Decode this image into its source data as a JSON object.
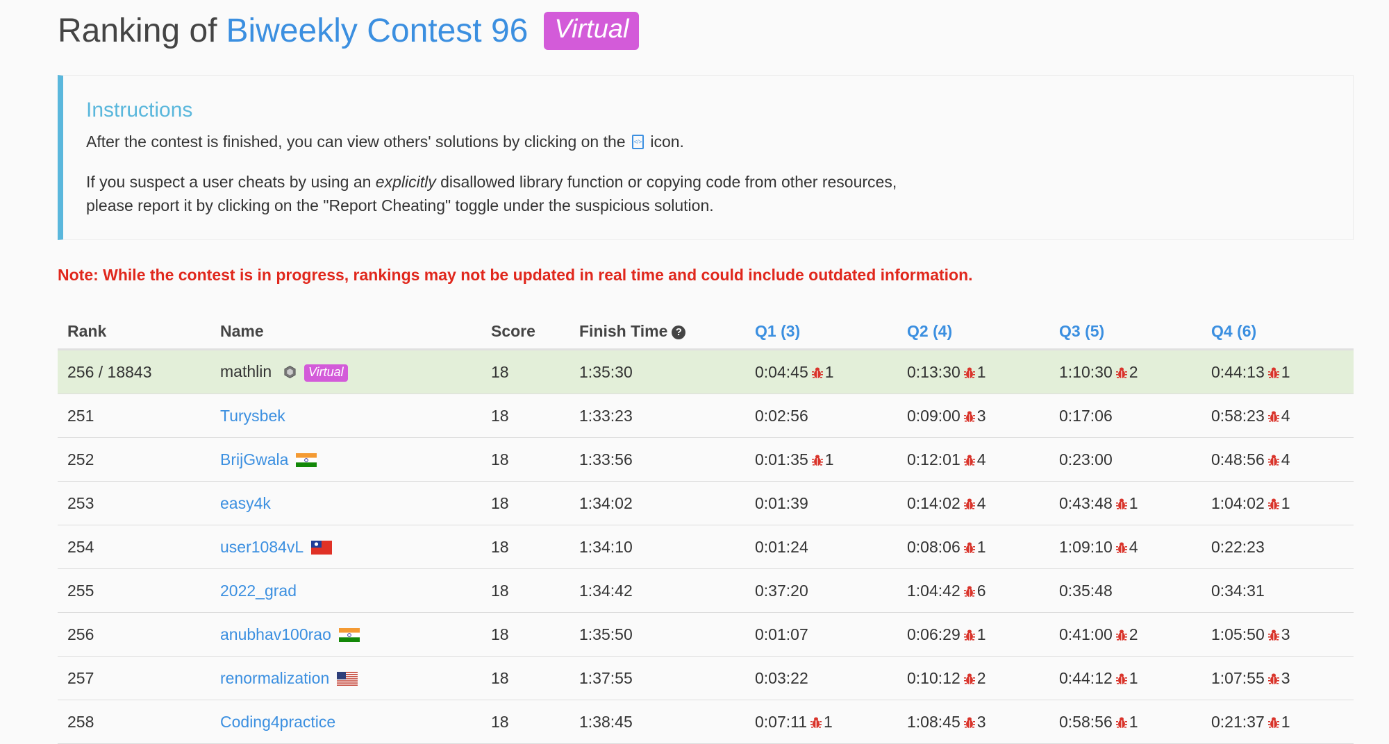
{
  "header": {
    "prefix": "Ranking of",
    "contest_name": "Biweekly Contest 96",
    "badge": "Virtual"
  },
  "instructions": {
    "title": "Instructions",
    "line1_before": "After the contest is finished, you can view others' solutions by clicking on the",
    "line1_after": "icon.",
    "line2_before": "If you suspect a user cheats by using an",
    "line2_em": "explicitly",
    "line2_after": "disallowed library function or copying code from other resources,",
    "line3": "please report it by clicking on the \"Report Cheating\" toggle under the suspicious solution."
  },
  "note": "Note: While the contest is in progress, rankings may not be updated in real time and could include outdated information.",
  "table": {
    "headers": {
      "rank": "Rank",
      "name": "Name",
      "score": "Score",
      "finish": "Finish Time",
      "q1": "Q1 (3)",
      "q2": "Q2 (4)",
      "q3": "Q3 (5)",
      "q4": "Q4 (6)"
    },
    "self_row": {
      "rank": "256 / 18843",
      "name": "mathlin",
      "badge": "Virtual",
      "score": "18",
      "finish": "1:35:30",
      "q1": {
        "time": "0:04:45",
        "wrong": "1"
      },
      "q2": {
        "time": "0:13:30",
        "wrong": "1"
      },
      "q3": {
        "time": "1:10:30",
        "wrong": "2"
      },
      "q4": {
        "time": "0:44:13",
        "wrong": "1"
      }
    },
    "rows": [
      {
        "rank": "251",
        "name": "Turysbek",
        "flag": "",
        "score": "18",
        "finish": "1:33:23",
        "q1": {
          "time": "0:02:56",
          "wrong": ""
        },
        "q2": {
          "time": "0:09:00",
          "wrong": "3"
        },
        "q3": {
          "time": "0:17:06",
          "wrong": ""
        },
        "q4": {
          "time": "0:58:23",
          "wrong": "4"
        }
      },
      {
        "rank": "252",
        "name": "BrijGwala",
        "flag": "india",
        "score": "18",
        "finish": "1:33:56",
        "q1": {
          "time": "0:01:35",
          "wrong": "1"
        },
        "q2": {
          "time": "0:12:01",
          "wrong": "4"
        },
        "q3": {
          "time": "0:23:00",
          "wrong": ""
        },
        "q4": {
          "time": "0:48:56",
          "wrong": "4"
        }
      },
      {
        "rank": "253",
        "name": "easy4k",
        "flag": "",
        "score": "18",
        "finish": "1:34:02",
        "q1": {
          "time": "0:01:39",
          "wrong": ""
        },
        "q2": {
          "time": "0:14:02",
          "wrong": "4"
        },
        "q3": {
          "time": "0:43:48",
          "wrong": "1"
        },
        "q4": {
          "time": "1:04:02",
          "wrong": "1"
        }
      },
      {
        "rank": "254",
        "name": "user1084vL",
        "flag": "taiwan",
        "score": "18",
        "finish": "1:34:10",
        "q1": {
          "time": "0:01:24",
          "wrong": ""
        },
        "q2": {
          "time": "0:08:06",
          "wrong": "1"
        },
        "q3": {
          "time": "1:09:10",
          "wrong": "4"
        },
        "q4": {
          "time": "0:22:23",
          "wrong": ""
        }
      },
      {
        "rank": "255",
        "name": "2022_grad",
        "flag": "",
        "score": "18",
        "finish": "1:34:42",
        "q1": {
          "time": "0:37:20",
          "wrong": ""
        },
        "q2": {
          "time": "1:04:42",
          "wrong": "6"
        },
        "q3": {
          "time": "0:35:48",
          "wrong": ""
        },
        "q4": {
          "time": "0:34:31",
          "wrong": ""
        }
      },
      {
        "rank": "256",
        "name": "anubhav100rao",
        "flag": "india",
        "score": "18",
        "finish": "1:35:50",
        "q1": {
          "time": "0:01:07",
          "wrong": ""
        },
        "q2": {
          "time": "0:06:29",
          "wrong": "1"
        },
        "q3": {
          "time": "0:41:00",
          "wrong": "2"
        },
        "q4": {
          "time": "1:05:50",
          "wrong": "3"
        }
      },
      {
        "rank": "257",
        "name": "renormalization",
        "flag": "usa",
        "score": "18",
        "finish": "1:37:55",
        "q1": {
          "time": "0:03:22",
          "wrong": ""
        },
        "q2": {
          "time": "0:10:12",
          "wrong": "2"
        },
        "q3": {
          "time": "0:44:12",
          "wrong": "1"
        },
        "q4": {
          "time": "1:07:55",
          "wrong": "3"
        }
      },
      {
        "rank": "258",
        "name": "Coding4practice",
        "flag": "",
        "score": "18",
        "finish": "1:38:45",
        "q1": {
          "time": "0:07:11",
          "wrong": "1"
        },
        "q2": {
          "time": "1:08:45",
          "wrong": "3"
        },
        "q3": {
          "time": "0:58:56",
          "wrong": "1"
        },
        "q4": {
          "time": "0:21:37",
          "wrong": "1"
        }
      }
    ]
  },
  "colors": {
    "accent": "#3b8fe0",
    "virtual_badge": "#d35bd9",
    "note": "#e0271c",
    "self_row_bg": "#e3efd9",
    "bug": "#d9342b"
  },
  "icons": {
    "code": "code-file-icon",
    "help": "question-circle-icon",
    "bug": "bug-icon",
    "avatar": "hexagon-avatar-icon"
  }
}
